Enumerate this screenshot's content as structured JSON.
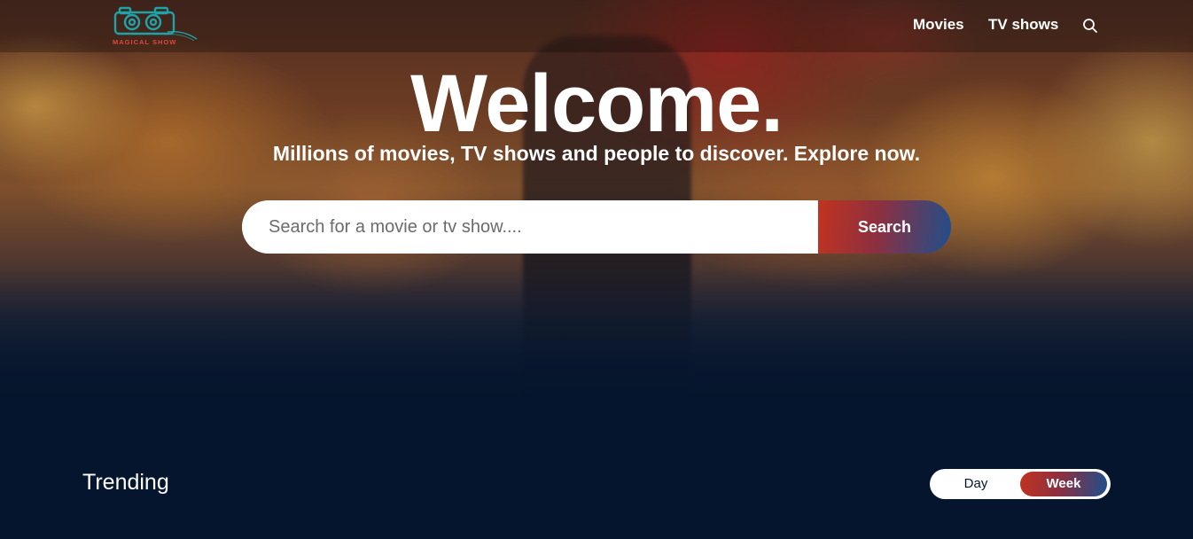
{
  "header": {
    "logo_text": "MAGICAL SHOW",
    "nav": {
      "movies": "Movies",
      "tv_shows": "TV shows",
      "search_icon": "search-icon"
    }
  },
  "hero": {
    "title": "Welcome.",
    "subtitle": "Millions of movies, TV shows and people to discover. Explore now.",
    "search": {
      "placeholder": "Search for a movie or tv show....",
      "value": "",
      "button_label": "Search"
    }
  },
  "trending": {
    "title": "Trending",
    "tabs": [
      "Day",
      "Week"
    ],
    "active_tab": "Week"
  },
  "colors": {
    "background": "#04152d",
    "gradient_start": "#c2331f",
    "gradient_end": "#1f4f8c",
    "logo_accent": "#e0473c",
    "logo_camera": "#1fa3a8"
  }
}
